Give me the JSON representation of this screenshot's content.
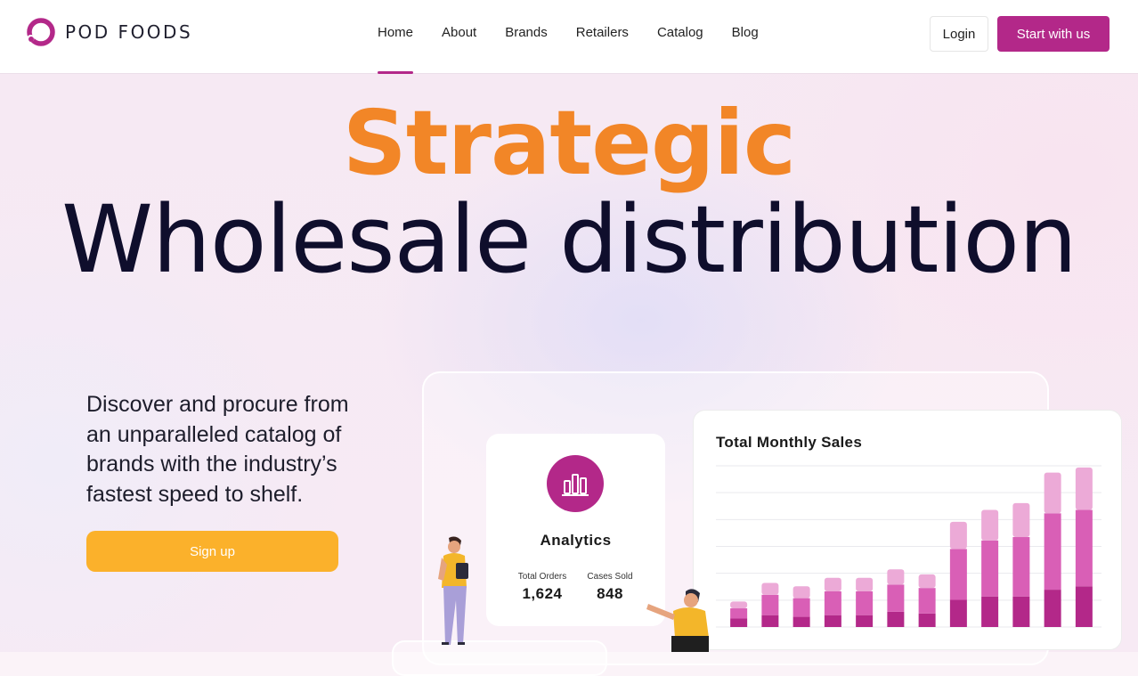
{
  "brand": {
    "name": "POD FOODS",
    "accent_color": "#b32889",
    "logo_icon": "pod-foods-ring-logo"
  },
  "nav": {
    "items": [
      {
        "label": "Home",
        "active": true
      },
      {
        "label": "About",
        "active": false
      },
      {
        "label": "Brands",
        "active": false
      },
      {
        "label": "Retailers",
        "active": false
      },
      {
        "label": "Catalog",
        "active": false
      },
      {
        "label": "Blog",
        "active": false
      }
    ],
    "login_label": "Login",
    "start_label": "Start with us"
  },
  "hero": {
    "headline_strong": "Strategic",
    "headline_main": "Wholesale distribution",
    "headline_strong_color": "#f28627",
    "subtext": "Discover and procure from an unparalleled catalog of brands with the industry’s fastest speed to shelf.",
    "signup_label": "Sign up",
    "signup_color": "#fbb12b"
  },
  "analytics": {
    "icon": "bar-chart-icon",
    "title": "Analytics",
    "stats": [
      {
        "label": "Total Orders",
        "value": "1,624"
      },
      {
        "label": "Cases Sold",
        "value": "848"
      }
    ]
  },
  "chart_data": {
    "type": "bar",
    "title": "Total Monthly Sales",
    "stacked": true,
    "grid": true,
    "series_colors": [
      "#b32889",
      "#d95fb6",
      "#ecaad7"
    ],
    "series": [
      {
        "values": [
          0.5,
          0.7,
          0.6,
          0.7,
          0.7,
          0.9,
          0.8,
          1.6,
          1.8,
          1.8,
          2.2,
          2.4
        ]
      },
      {
        "values": [
          0.6,
          1.2,
          1.1,
          1.4,
          1.4,
          1.6,
          1.5,
          3.0,
          3.3,
          3.5,
          4.5,
          4.5
        ]
      },
      {
        "values": [
          0.4,
          0.7,
          0.7,
          0.8,
          0.8,
          0.9,
          0.8,
          1.6,
          1.8,
          2.0,
          2.4,
          2.5
        ]
      }
    ],
    "ylim": [
      0,
      9.5
    ]
  }
}
